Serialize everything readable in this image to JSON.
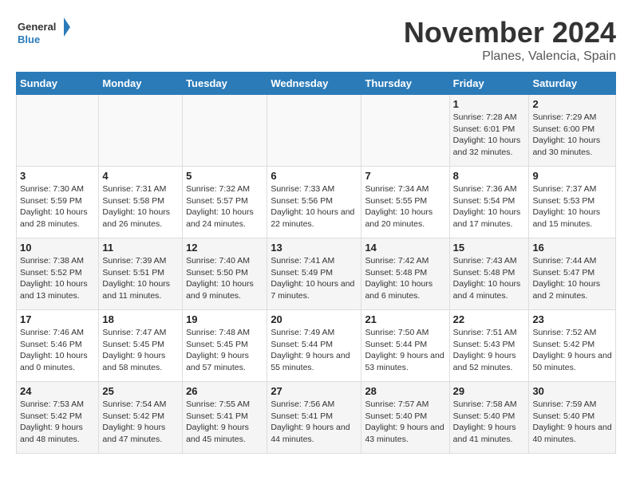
{
  "header": {
    "logo_line1": "General",
    "logo_line2": "Blue",
    "month": "November 2024",
    "location": "Planes, Valencia, Spain"
  },
  "days_of_week": [
    "Sunday",
    "Monday",
    "Tuesday",
    "Wednesday",
    "Thursday",
    "Friday",
    "Saturday"
  ],
  "weeks": [
    [
      {
        "day": "",
        "info": ""
      },
      {
        "day": "",
        "info": ""
      },
      {
        "day": "",
        "info": ""
      },
      {
        "day": "",
        "info": ""
      },
      {
        "day": "",
        "info": ""
      },
      {
        "day": "1",
        "info": "Sunrise: 7:28 AM\nSunset: 6:01 PM\nDaylight: 10 hours and 32 minutes."
      },
      {
        "day": "2",
        "info": "Sunrise: 7:29 AM\nSunset: 6:00 PM\nDaylight: 10 hours and 30 minutes."
      }
    ],
    [
      {
        "day": "3",
        "info": "Sunrise: 7:30 AM\nSunset: 5:59 PM\nDaylight: 10 hours and 28 minutes."
      },
      {
        "day": "4",
        "info": "Sunrise: 7:31 AM\nSunset: 5:58 PM\nDaylight: 10 hours and 26 minutes."
      },
      {
        "day": "5",
        "info": "Sunrise: 7:32 AM\nSunset: 5:57 PM\nDaylight: 10 hours and 24 minutes."
      },
      {
        "day": "6",
        "info": "Sunrise: 7:33 AM\nSunset: 5:56 PM\nDaylight: 10 hours and 22 minutes."
      },
      {
        "day": "7",
        "info": "Sunrise: 7:34 AM\nSunset: 5:55 PM\nDaylight: 10 hours and 20 minutes."
      },
      {
        "day": "8",
        "info": "Sunrise: 7:36 AM\nSunset: 5:54 PM\nDaylight: 10 hours and 17 minutes."
      },
      {
        "day": "9",
        "info": "Sunrise: 7:37 AM\nSunset: 5:53 PM\nDaylight: 10 hours and 15 minutes."
      }
    ],
    [
      {
        "day": "10",
        "info": "Sunrise: 7:38 AM\nSunset: 5:52 PM\nDaylight: 10 hours and 13 minutes."
      },
      {
        "day": "11",
        "info": "Sunrise: 7:39 AM\nSunset: 5:51 PM\nDaylight: 10 hours and 11 minutes."
      },
      {
        "day": "12",
        "info": "Sunrise: 7:40 AM\nSunset: 5:50 PM\nDaylight: 10 hours and 9 minutes."
      },
      {
        "day": "13",
        "info": "Sunrise: 7:41 AM\nSunset: 5:49 PM\nDaylight: 10 hours and 7 minutes."
      },
      {
        "day": "14",
        "info": "Sunrise: 7:42 AM\nSunset: 5:48 PM\nDaylight: 10 hours and 6 minutes."
      },
      {
        "day": "15",
        "info": "Sunrise: 7:43 AM\nSunset: 5:48 PM\nDaylight: 10 hours and 4 minutes."
      },
      {
        "day": "16",
        "info": "Sunrise: 7:44 AM\nSunset: 5:47 PM\nDaylight: 10 hours and 2 minutes."
      }
    ],
    [
      {
        "day": "17",
        "info": "Sunrise: 7:46 AM\nSunset: 5:46 PM\nDaylight: 10 hours and 0 minutes."
      },
      {
        "day": "18",
        "info": "Sunrise: 7:47 AM\nSunset: 5:45 PM\nDaylight: 9 hours and 58 minutes."
      },
      {
        "day": "19",
        "info": "Sunrise: 7:48 AM\nSunset: 5:45 PM\nDaylight: 9 hours and 57 minutes."
      },
      {
        "day": "20",
        "info": "Sunrise: 7:49 AM\nSunset: 5:44 PM\nDaylight: 9 hours and 55 minutes."
      },
      {
        "day": "21",
        "info": "Sunrise: 7:50 AM\nSunset: 5:44 PM\nDaylight: 9 hours and 53 minutes."
      },
      {
        "day": "22",
        "info": "Sunrise: 7:51 AM\nSunset: 5:43 PM\nDaylight: 9 hours and 52 minutes."
      },
      {
        "day": "23",
        "info": "Sunrise: 7:52 AM\nSunset: 5:42 PM\nDaylight: 9 hours and 50 minutes."
      }
    ],
    [
      {
        "day": "24",
        "info": "Sunrise: 7:53 AM\nSunset: 5:42 PM\nDaylight: 9 hours and 48 minutes."
      },
      {
        "day": "25",
        "info": "Sunrise: 7:54 AM\nSunset: 5:42 PM\nDaylight: 9 hours and 47 minutes."
      },
      {
        "day": "26",
        "info": "Sunrise: 7:55 AM\nSunset: 5:41 PM\nDaylight: 9 hours and 45 minutes."
      },
      {
        "day": "27",
        "info": "Sunrise: 7:56 AM\nSunset: 5:41 PM\nDaylight: 9 hours and 44 minutes."
      },
      {
        "day": "28",
        "info": "Sunrise: 7:57 AM\nSunset: 5:40 PM\nDaylight: 9 hours and 43 minutes."
      },
      {
        "day": "29",
        "info": "Sunrise: 7:58 AM\nSunset: 5:40 PM\nDaylight: 9 hours and 41 minutes."
      },
      {
        "day": "30",
        "info": "Sunrise: 7:59 AM\nSunset: 5:40 PM\nDaylight: 9 hours and 40 minutes."
      }
    ]
  ]
}
